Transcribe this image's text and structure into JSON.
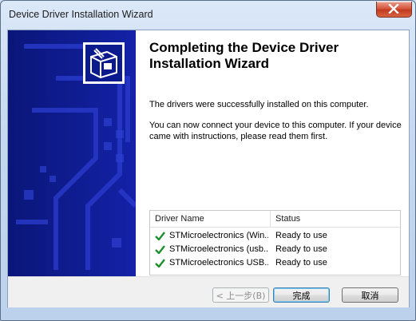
{
  "window": {
    "title": "Device Driver Installation Wizard"
  },
  "heading": "Completing the Device Driver Installation Wizard",
  "paragraphs": {
    "success": "The drivers were successfully installed on this computer.",
    "instructions": "You can now connect your device to this computer. If your device came with instructions, please read them first."
  },
  "table": {
    "headers": {
      "name": "Driver Name",
      "status": "Status"
    },
    "rows": [
      {
        "name": "STMicroelectronics (Win...",
        "status": "Ready to use",
        "icon": "green-check-icon"
      },
      {
        "name": "STMicroelectronics (usb...",
        "status": "Ready to use",
        "icon": "green-check-icon"
      },
      {
        "name": "STMicroelectronics USB...",
        "status": "Ready to use",
        "icon": "green-check-icon"
      }
    ]
  },
  "buttons": {
    "back": "< 上一步(B)",
    "finish": "完成",
    "cancel": "取消"
  },
  "colors": {
    "sidebar": "#0b1a8c",
    "sidebar_pattern": "#2535c2",
    "check": "#1f8f2d",
    "close": "#c8442a"
  },
  "icons": {
    "wizard_logo": "hardware-box-icon",
    "close": "close-icon"
  }
}
